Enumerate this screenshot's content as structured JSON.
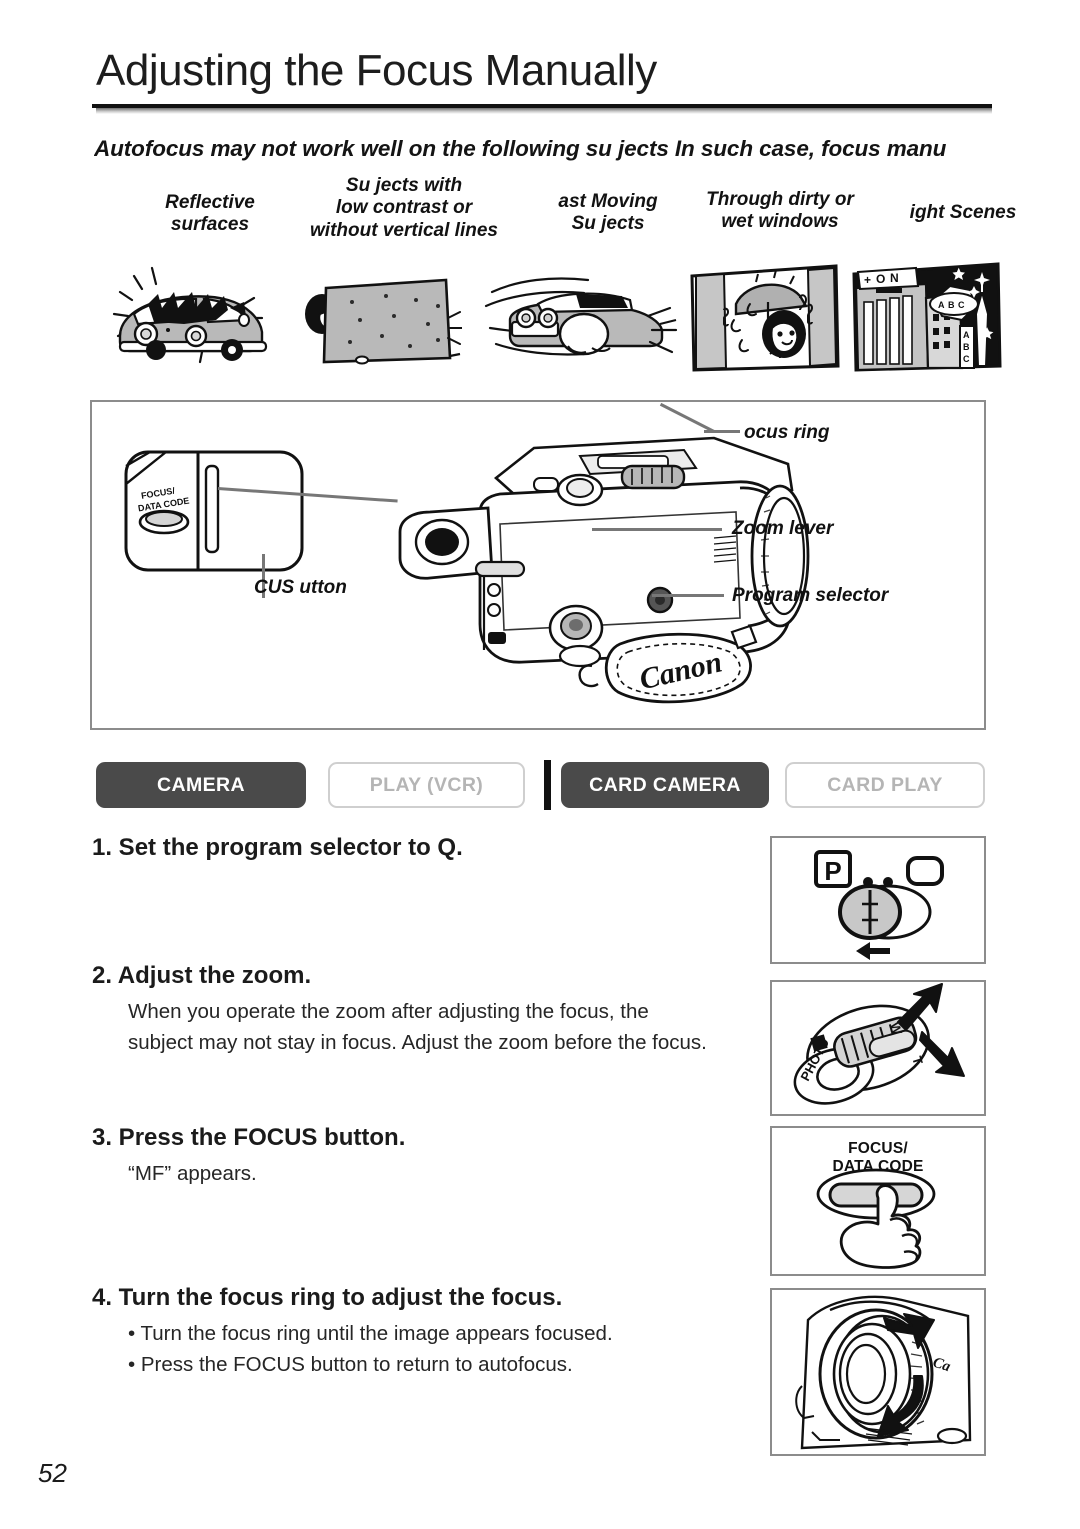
{
  "page": {
    "title": "Adjusting the Focus Manually",
    "number": "52",
    "intro": "Autofocus may not work well on the following su jects  In such case, focus manu"
  },
  "conditions": [
    {
      "caption": "Reflective\nsurfaces",
      "illustration": "shiny-car-icon"
    },
    {
      "caption": "Su jects with\nlow contrast or\nwithout vertical lines",
      "illustration": "blank-board-icon"
    },
    {
      "caption": "ast Moving\nSu jects",
      "illustration": "fast-car-icon"
    },
    {
      "caption": "Through dirty or\nwet windows",
      "illustration": "rainy-window-icon"
    },
    {
      "caption": "ight Scenes",
      "illustration": "night-city-icon"
    }
  ],
  "diagram": {
    "labels": {
      "focus_ring": "ocus ring",
      "zoom_lever": "Zoom lever",
      "program_selector": "Program selector",
      "focus_button": "CUS  utton"
    },
    "inset_button_text_line1": "FOCUS/",
    "inset_button_text_line2": "DATA CODE",
    "brand": "Canon"
  },
  "modes": [
    {
      "label": "CAMERA",
      "active": true
    },
    {
      "label": "PLAY (VCR)",
      "active": false
    },
    {
      "label": "CARD CAMERA",
      "active": true
    },
    {
      "label": "CARD PLAY",
      "active": false
    }
  ],
  "steps": [
    {
      "heading": "1. Set the program selector to Q.",
      "body": []
    },
    {
      "heading": "2. Adjust the zoom.",
      "body": [
        "When you operate the zoom after adjusting the focus, the",
        "subject may not stay in focus. Adjust the zoom before the focus."
      ]
    },
    {
      "heading": "3. Press the FOCUS button.",
      "body": [
        "“MF” appears."
      ]
    },
    {
      "heading": "4. Turn the focus ring to adjust the focus.",
      "body": [
        "• Turn the focus ring until the image appears focused.",
        "• Press the FOCUS button to return to autofocus."
      ]
    }
  ],
  "panels": [
    {
      "name": "program-selector-panel",
      "symbols": {
        "program_mode": "P",
        "easy_mode": "□"
      }
    },
    {
      "name": "zoom-lever-panel",
      "symbols": {
        "wide": "W",
        "tele": "T",
        "photo": "PHOTO"
      }
    },
    {
      "name": "focus-button-panel",
      "caption_line1": "FOCUS/",
      "caption_line2": "DATA CODE"
    },
    {
      "name": "focus-ring-panel",
      "symbols": {}
    }
  ],
  "colors": {
    "active_tab_bg": "#4a4a4a",
    "inactive_tab_border": "#cfcfcf",
    "inactive_tab_text": "#b5b5b5",
    "box_border": "#8c8c8c",
    "ink": "#1a1a1a"
  }
}
